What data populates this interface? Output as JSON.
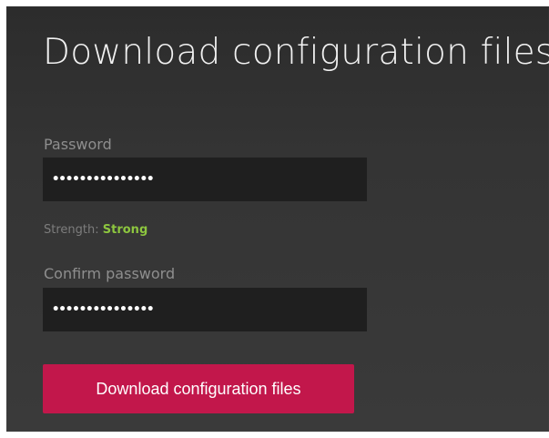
{
  "page": {
    "title": "Download configuration files"
  },
  "form": {
    "password": {
      "label": "Password",
      "value": "•••••••••••••••"
    },
    "strength": {
      "label": "Strength:",
      "value": "Strong",
      "value_color": "#8dc63f"
    },
    "confirm_password": {
      "label": "Confirm password",
      "value": "•••••••••••••••"
    },
    "submit": {
      "label": "Download configuration files",
      "color": "#c2174b"
    }
  }
}
